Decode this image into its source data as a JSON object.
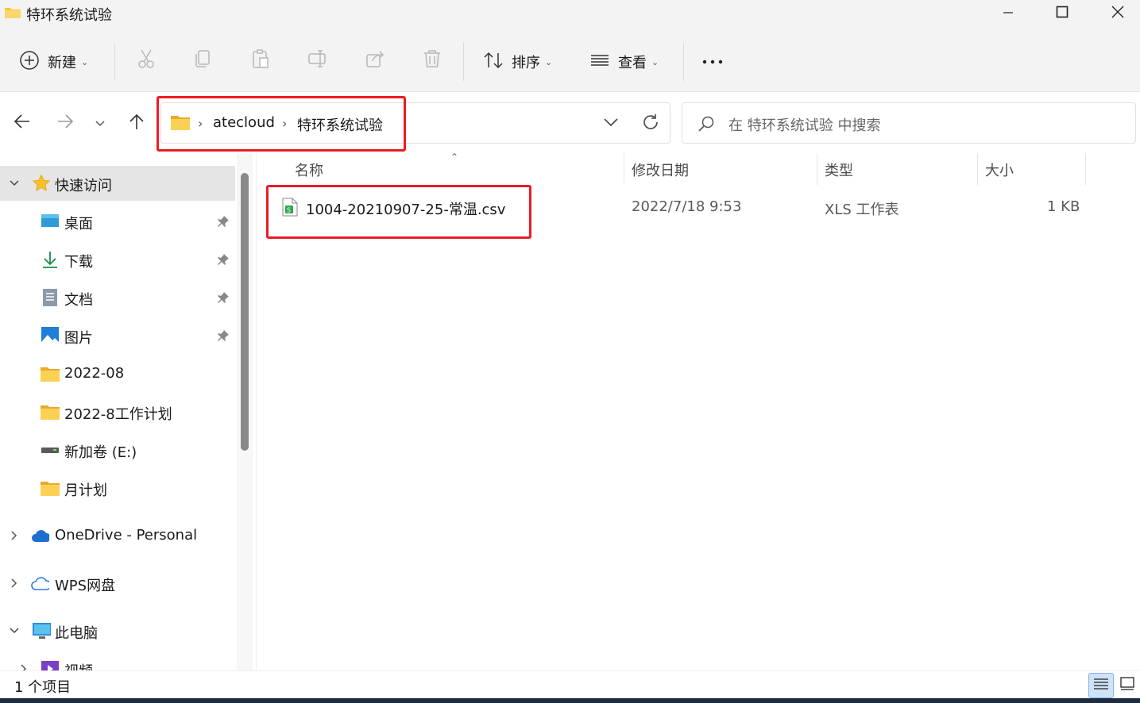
{
  "window": {
    "title": "特环系统试验",
    "icons": {
      "app": "folder-icon",
      "minimize": "minimize-icon",
      "maximize": "maximize-icon",
      "close": "close-icon"
    }
  },
  "command_bar": {
    "new_label": "新建",
    "sort_label": "排序",
    "view_label": "查看",
    "more_icon": "more-icon",
    "actions": [
      "cut-icon",
      "copy-icon",
      "paste-icon",
      "rename-icon",
      "share-icon",
      "delete-icon"
    ]
  },
  "address_bar": {
    "breadcrumbs": [
      "atecloud",
      "特环系统试验"
    ],
    "search_placeholder": "在 特环系统试验 中搜索"
  },
  "sidebar": {
    "quick_access": "快速访问",
    "items": [
      {
        "label": "桌面",
        "icon": "desktop-icon",
        "pinned": true
      },
      {
        "label": "下载",
        "icon": "download-icon",
        "pinned": true
      },
      {
        "label": "文档",
        "icon": "document-icon",
        "pinned": true
      },
      {
        "label": "图片",
        "icon": "pictures-icon",
        "pinned": true
      },
      {
        "label": "2022-08",
        "icon": "folder-icon",
        "pinned": false
      },
      {
        "label": "2022-8工作计划",
        "icon": "folder-icon",
        "pinned": false
      },
      {
        "label": "新加卷 (E:)",
        "icon": "drive-icon",
        "pinned": false
      },
      {
        "label": "月计划",
        "icon": "folder-icon",
        "pinned": false
      }
    ],
    "onedrive": "OneDrive - Personal",
    "wps": "WPS网盘",
    "this_pc": "此电脑",
    "videos": "视频"
  },
  "file_list": {
    "columns": [
      "名称",
      "修改日期",
      "类型",
      "大小"
    ],
    "rows": [
      {
        "name": "1004-20210907-25-常温.csv",
        "modified": "2022/7/18 9:53",
        "type": "XLS 工作表",
        "size": "1 KB",
        "icon": "spreadsheet-icon"
      }
    ]
  },
  "status_bar": {
    "item_count": "1 个项目"
  },
  "colors": {
    "highlight": "#ec1c24",
    "selection": "#e5e5e5",
    "folder": "#f8c83c"
  }
}
